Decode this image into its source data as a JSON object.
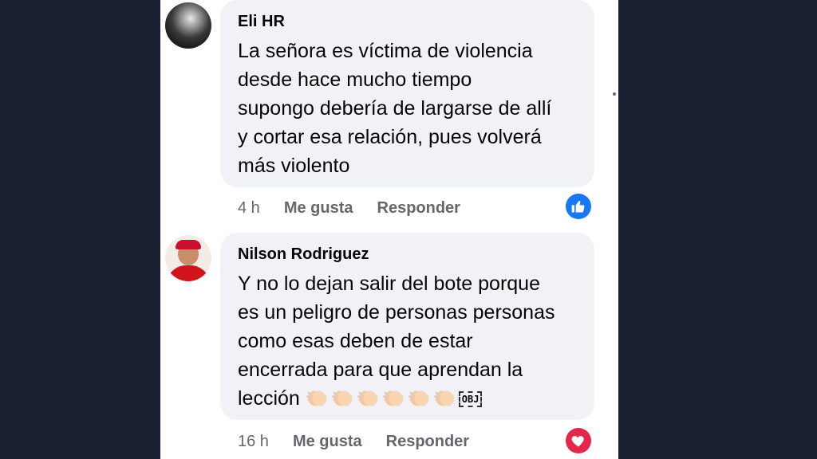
{
  "comments": [
    {
      "author": "Eli HR",
      "text": "La señora es víctima de violencia\ndesde hace mucho tiempo\nsupongo debería de largarse de allí\ny cortar esa relación, pues volverá\nmás violento",
      "time": "4 h",
      "like_label": "Me gusta",
      "reply_label": "Responder",
      "reaction": "like-icon",
      "reaction_color": "#1877f2"
    },
    {
      "author": "Nilson Rodriguez",
      "text": "Y no lo dejan salir del bote porque\nes un peligro de personas personas\ncomo esas deben de estar\nencerrada para que aprendan la\nlección ",
      "emoji": "clapping-hands-icon",
      "emoji_count": 6,
      "obj_glyph": "OBJ",
      "time": "16 h",
      "like_label": "Me gusta",
      "reply_label": "Responder",
      "reaction": "heart-icon",
      "reaction_color": "#e4264a"
    }
  ],
  "colors": {
    "background": "#1c2033",
    "bubble": "#f0f2f5",
    "meta_text": "#65676b"
  }
}
